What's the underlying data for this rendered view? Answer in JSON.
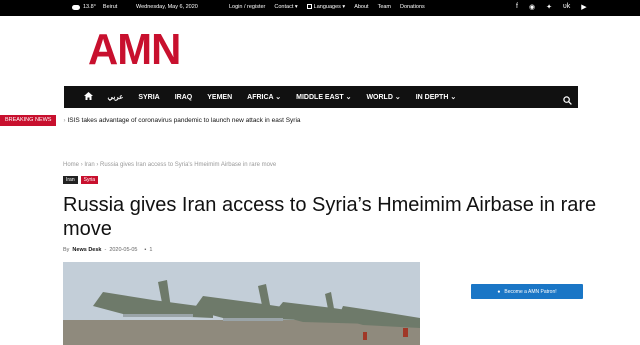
{
  "topbar": {
    "temperature": "13.8",
    "temp_unit": "°",
    "city": "Beirut",
    "date": "Wednesday, May 6, 2020",
    "links": [
      {
        "label": "Login / register"
      },
      {
        "label": "Contact"
      },
      {
        "label": "Languages"
      },
      {
        "label": "About"
      },
      {
        "label": "Team"
      },
      {
        "label": "Donations"
      }
    ],
    "socials": [
      "facebook-icon",
      "reddit-icon",
      "twitter-icon",
      "vk-icon",
      "youtube-icon"
    ]
  },
  "logo": {
    "text": "AMN",
    "color": "#c8102e"
  },
  "nav": {
    "items": [
      {
        "label": "عربي"
      },
      {
        "label": "SYRIA"
      },
      {
        "label": "IRAQ"
      },
      {
        "label": "YEMEN"
      },
      {
        "label": "AFRICA"
      },
      {
        "label": "MIDDLE EAST"
      },
      {
        "label": "WORLD"
      },
      {
        "label": "IN DEPTH"
      }
    ]
  },
  "breaking": {
    "badge": "BREAKING NEWS",
    "headline": "ISIS takes advantage of coronavirus pandemic to launch new attack in east Syria"
  },
  "breadcrumb": {
    "home": "Home",
    "category": "Iran",
    "current": "Russia gives Iran access to Syria's Hmeimim Airbase in rare move"
  },
  "tags": [
    "Iran",
    "Syria"
  ],
  "article": {
    "title": "Russia gives Iran access to Syria’s Hmeimim Airbase in rare move",
    "by": "By",
    "author": "News Desk",
    "date": "2020-05-05",
    "comments": "1"
  },
  "sidebar": {
    "patreon_label": "Become a AMN Patron!"
  },
  "colors": {
    "brand_red": "#c8102e",
    "nav_bg": "#111111",
    "patreon_blue": "#1a76c6"
  }
}
